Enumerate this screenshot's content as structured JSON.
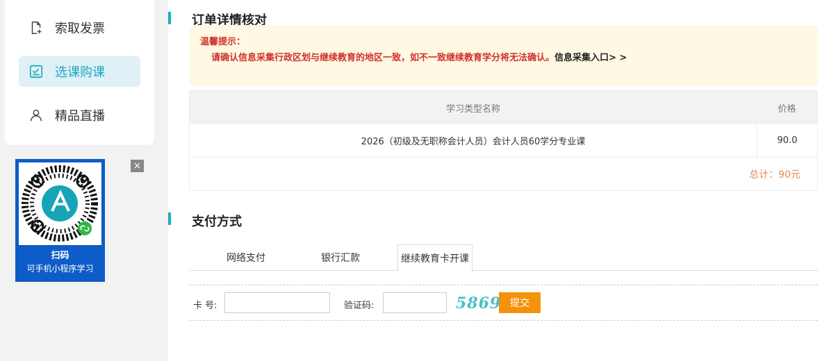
{
  "sidebar": {
    "items": [
      {
        "label": "索取发票",
        "icon": "invoice-add-icon",
        "active": false
      },
      {
        "label": "选课购课",
        "icon": "checkbox-icon",
        "active": true
      },
      {
        "label": "精品直播",
        "icon": "user-icon",
        "active": false
      }
    ]
  },
  "promo": {
    "line1": "扫码",
    "line2": "可手机小程序学习",
    "close_symbol": "×"
  },
  "order": {
    "title": "订单详情核对",
    "notice_title": "温馨提示：",
    "notice_body": "请确认信息采集行政区划与继续教育的地区一致，如不一致继续教育学分将无法确认。",
    "notice_link": "信息采集入口> >",
    "table": {
      "headers": [
        "学习类型名称",
        "价格"
      ],
      "rows": [
        {
          "name": "2026（初级及无职称会计人员）会计人员60学分专业课",
          "price": "90.0"
        }
      ],
      "total": "总计：90元"
    }
  },
  "payment": {
    "title": "支付方式",
    "tabs": [
      {
        "label": "网络支付",
        "active": false
      },
      {
        "label": "银行汇款",
        "active": false
      },
      {
        "label": "继续教育卡开课",
        "active": true
      }
    ],
    "card_label": "卡 号:",
    "card_value": "",
    "captcha_label": "验证码:",
    "captcha_value": "",
    "captcha_text": "5869",
    "submit_label": "提交"
  },
  "colors": {
    "accent": "#19b0c0",
    "active_bg": "#dff1f6",
    "warning": "#d0302c",
    "total": "#e98a4f",
    "submit": "#f5920b",
    "promo_bg": "#0d5cc7"
  }
}
